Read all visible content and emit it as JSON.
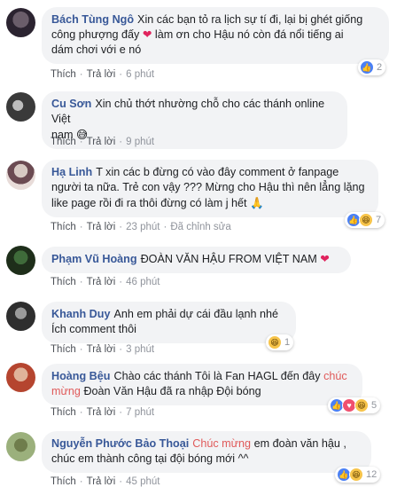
{
  "actions": {
    "like": "Thích",
    "reply": "Trả lời",
    "edited": "Đã chỉnh sửa"
  },
  "comments": [
    {
      "name": "Bách Tùng Ngô",
      "text1": "Xin các bạn tỏ ra lịch sự tí đi, lại bị ghét giống",
      "text2": "công phượng đấy",
      "text3": "làm ơn cho Hậu nó còn đá nổi tiếng ai",
      "text4": "dám chơi với e nó",
      "time": "6 phút",
      "reactions": "2",
      "reaction_icons": [
        "like-icon"
      ]
    },
    {
      "name": "Cu Sơn",
      "text1": "Xin chủ thớt nhường chỗ cho các thánh online Việt",
      "text2": "nam",
      "time": "9 phút",
      "reaction_icons": [
        "laughing-emoji"
      ]
    },
    {
      "name": "Hạ Linh",
      "text1": "T xin các b đừng có vào đây comment ở fanpage",
      "text2": "người ta nữa. Trẻ con vậy ??? Mừng cho Hậu thì nên lẳng lặng",
      "text3": "like page rồi đi ra thôi đừng có làm j hết",
      "time": "23 phút",
      "reactions": "7",
      "reaction_icons": [
        "like-icon",
        "haha-icon"
      ]
    },
    {
      "name": "Phạm Vũ Hoàng",
      "text1": "ĐOÀN VĂN HẬU FROM VIỆT NAM",
      "time": "46 phút"
    },
    {
      "name": "Khanh Duy",
      "text1": "Anh em phải dự cái đầu lạnh nhé",
      "text2": "Ích comment thôi",
      "time": "3 phút",
      "reactions": "1",
      "reaction_icons": [
        "haha-icon"
      ]
    },
    {
      "name": "Hoàng Bệu",
      "text1": "Chào các thánh Tôi là Fan HAGL đến đây",
      "highlight": "chúc mừng",
      "text2": "Đoàn Văn Hậu đã ra nhập Đội bóng",
      "time": "7 phút",
      "reactions": "5",
      "reaction_icons": [
        "like-icon",
        "love-icon",
        "haha-icon"
      ]
    },
    {
      "name": "Nguyễn Phước Bảo Thoại",
      "highlight": "Chúc mừng",
      "text1": "em đoàn văn hậu ,",
      "text2": "chúc em thành công tại đội bóng mới ^^",
      "time": "45 phút",
      "reactions": "12",
      "reaction_icons": [
        "like-icon",
        "haha-icon"
      ]
    }
  ]
}
